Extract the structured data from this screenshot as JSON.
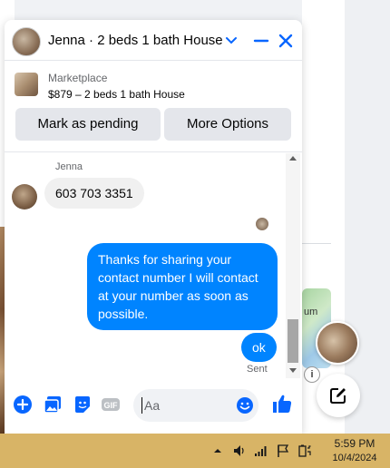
{
  "chat": {
    "title": "Jenna · 2 beds 1 bath House",
    "marketplace_label": "Marketplace",
    "listing": "$879 – 2 beds 1 bath House",
    "mark_pending_label": "Mark as pending",
    "more_options_label": "More Options"
  },
  "messages": {
    "sender_name": "Jenna",
    "incoming": "603 703 3351",
    "outgoing": "Thanks for sharing your contact number I will contact at your number as soon as possible.",
    "outgoing_short": "ok",
    "status": "Sent"
  },
  "composer": {
    "placeholder": "Aa",
    "icons": [
      "plus-icon",
      "photo-icon",
      "sticker-icon",
      "gif-icon",
      "emoji-icon",
      "like-icon"
    ]
  },
  "background": {
    "map_text": "um",
    "info_glyph": "i"
  },
  "taskbar": {
    "time": "5:59 PM",
    "date": "10/4/2024"
  },
  "colors": {
    "accent": "#0866ff",
    "outgoing_bubble": "#0084ff",
    "incoming_bubble": "#f0f0f0",
    "taskbar": "#d8b466"
  }
}
